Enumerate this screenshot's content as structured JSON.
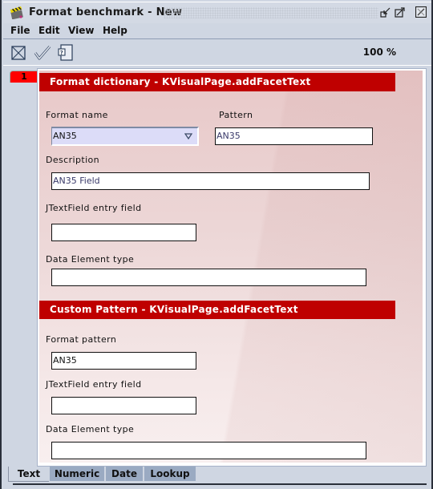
{
  "window": {
    "title": "Format  benchmark - New",
    "controls": [
      "iconify-icon",
      "maximize-icon",
      "close-icon"
    ]
  },
  "menu": [
    "File",
    "Edit",
    "View",
    "Help"
  ],
  "toolbar": {
    "icons": [
      "cancel-icon",
      "confirm-check-icon",
      "help-document-icon"
    ],
    "zoom": "100 %"
  },
  "page_tab": "1",
  "sections": [
    {
      "header": "Format dictionary - KVisualPage.addFacetText",
      "fields": {
        "format_name": {
          "label": "Format name",
          "value": "AN35"
        },
        "pattern": {
          "label": "Pattern",
          "value": "AN35"
        },
        "description": {
          "label": "Description",
          "value": "AN35 Field"
        },
        "entry": {
          "label": "JTextField entry field",
          "value": ""
        },
        "data_type": {
          "label": "Data Element type",
          "value": ""
        }
      }
    },
    {
      "header": "Custom Pattern - KVisualPage.addFacetText",
      "fields": {
        "format_pattern": {
          "label": "Format pattern",
          "value": "AN35"
        },
        "entry": {
          "label": "JTextField entry field",
          "value": ""
        },
        "data_type": {
          "label": "Data Element type",
          "value": ""
        }
      }
    }
  ],
  "tabs": [
    {
      "label": "Text",
      "active": true
    },
    {
      "label": "Numeric",
      "active": false
    },
    {
      "label": "Date",
      "active": false
    },
    {
      "label": "Lookup",
      "active": false
    }
  ],
  "colors": {
    "section_header": "#bf0000",
    "page_tab": "#ff0000",
    "combo_bg": "#dcdcf8",
    "chrome": "#cfd6e2"
  }
}
